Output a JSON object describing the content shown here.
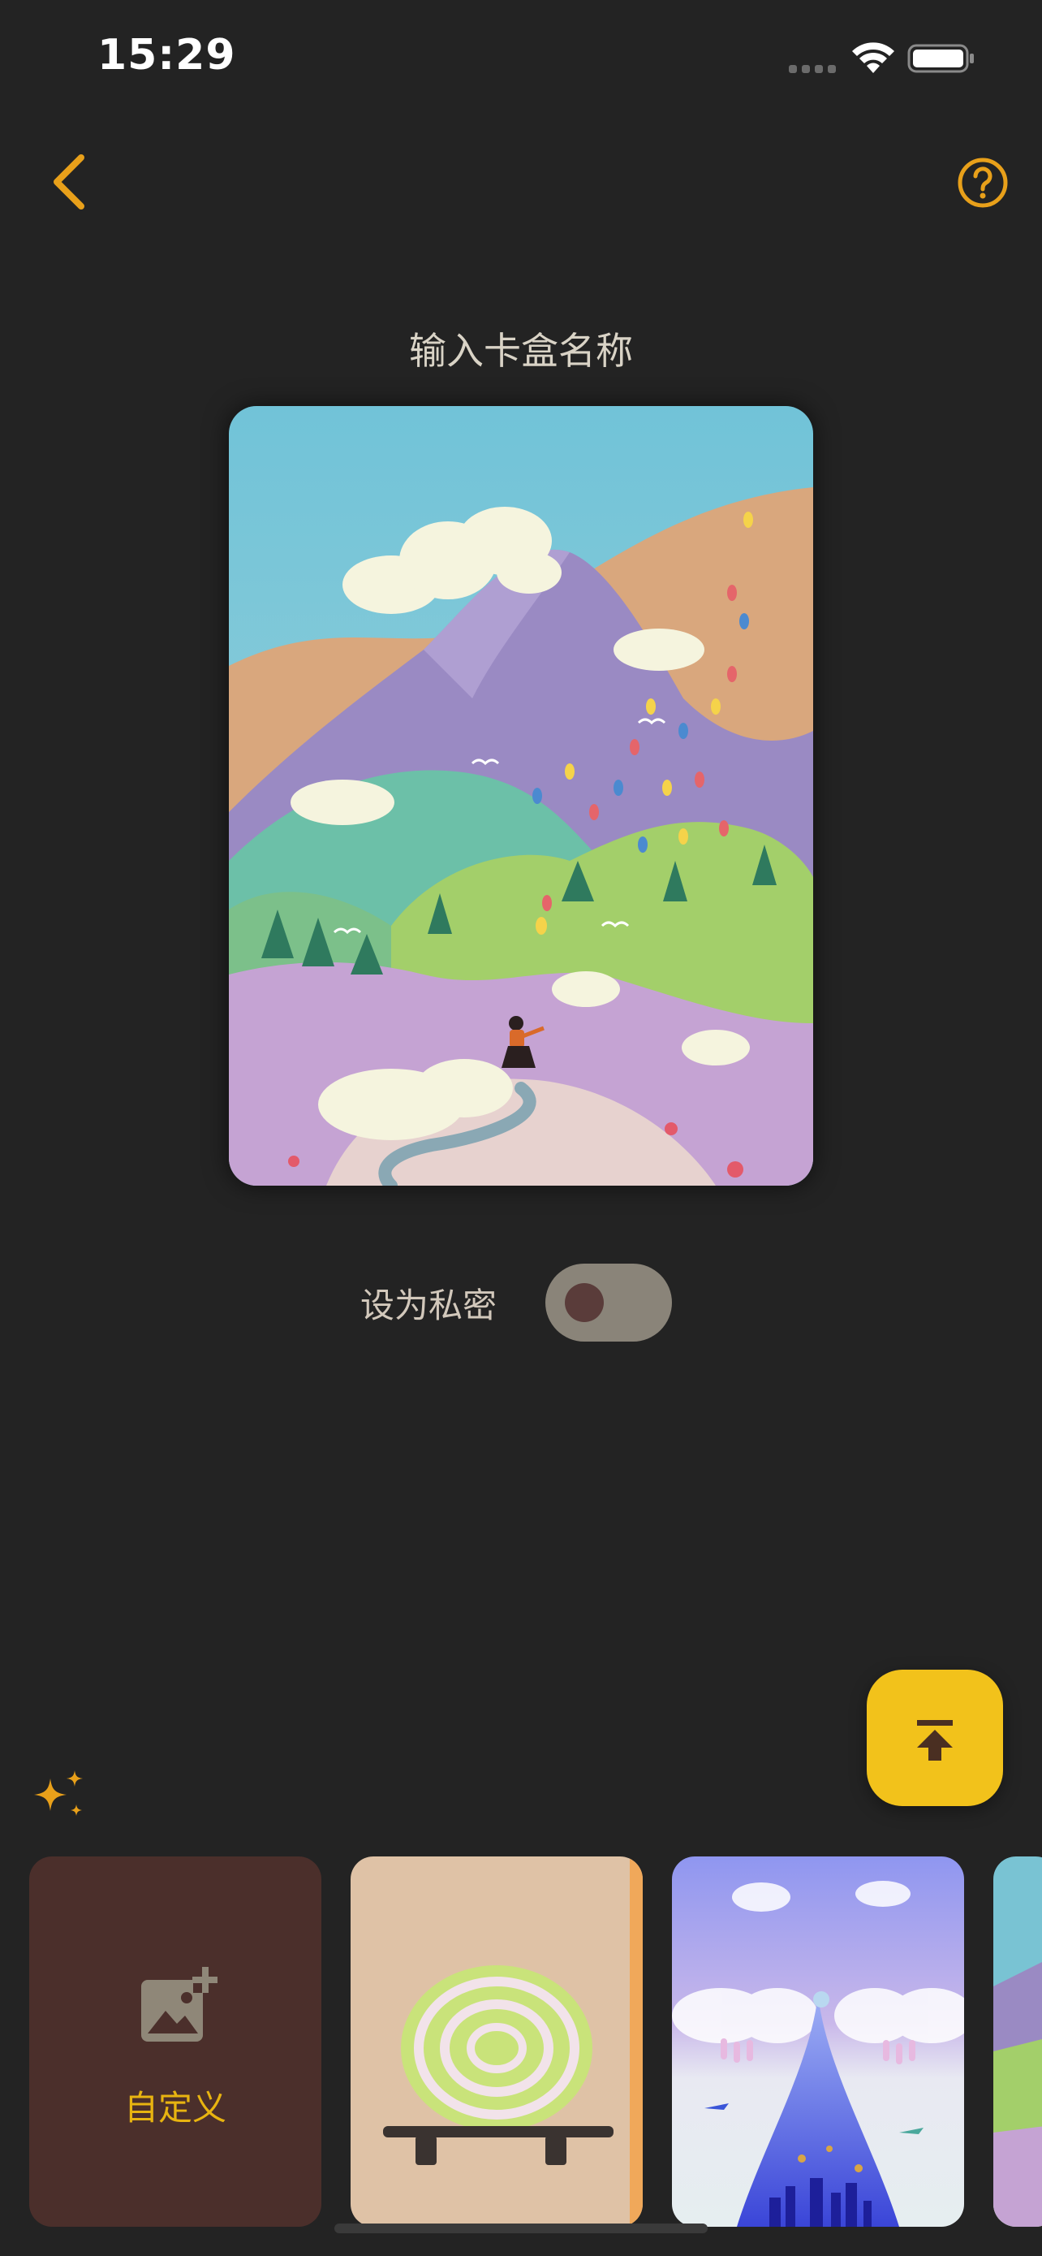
{
  "status_bar": {
    "time": "15:29"
  },
  "nav": {
    "back_icon": "chevron-left-icon",
    "help_icon": "help-circle-icon"
  },
  "title": "输入卡盒名称",
  "private": {
    "label": "设为私密",
    "enabled": false
  },
  "colors": {
    "accent": "#e8a01a",
    "fab": "#f2c21b",
    "background": "#232323"
  },
  "carousel": {
    "custom_label": "自定义",
    "cards": [
      {
        "name": "custom",
        "icon": "add-image-icon"
      },
      {
        "name": "green-roll-cake"
      },
      {
        "name": "sky-fountain-city"
      },
      {
        "name": "mountain-partial"
      }
    ]
  }
}
